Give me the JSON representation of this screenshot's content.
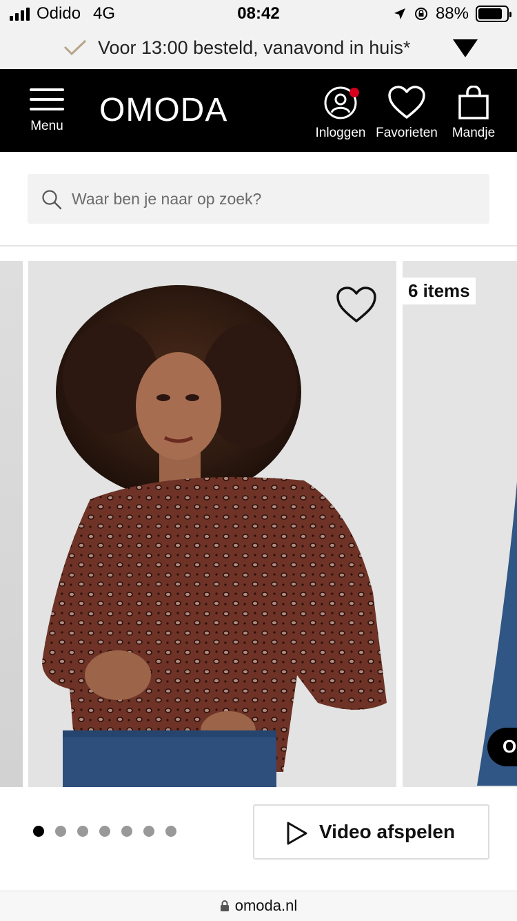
{
  "status_bar": {
    "carrier": "Odido",
    "network": "4G",
    "time": "08:42",
    "battery": "88%"
  },
  "banner": {
    "text": "Voor 13:00 besteld, vanavond in huis*"
  },
  "header": {
    "menu_label": "Menu",
    "logo": "OMODA",
    "login_label": "Inloggen",
    "favorites_label": "Favorieten",
    "cart_label": "Mandje"
  },
  "search": {
    "placeholder": "Waar ben je naar op zoek?"
  },
  "gallery": {
    "next_badge": "6 items",
    "video_pill": "O",
    "total_slides": 7,
    "active_slide": 1
  },
  "video_button": {
    "label": "Video afspelen"
  },
  "browser": {
    "url": "omoda.nl"
  },
  "colors": {
    "header_bg": "#000000",
    "notification": "#d6001c",
    "check": "#b5a58a"
  }
}
